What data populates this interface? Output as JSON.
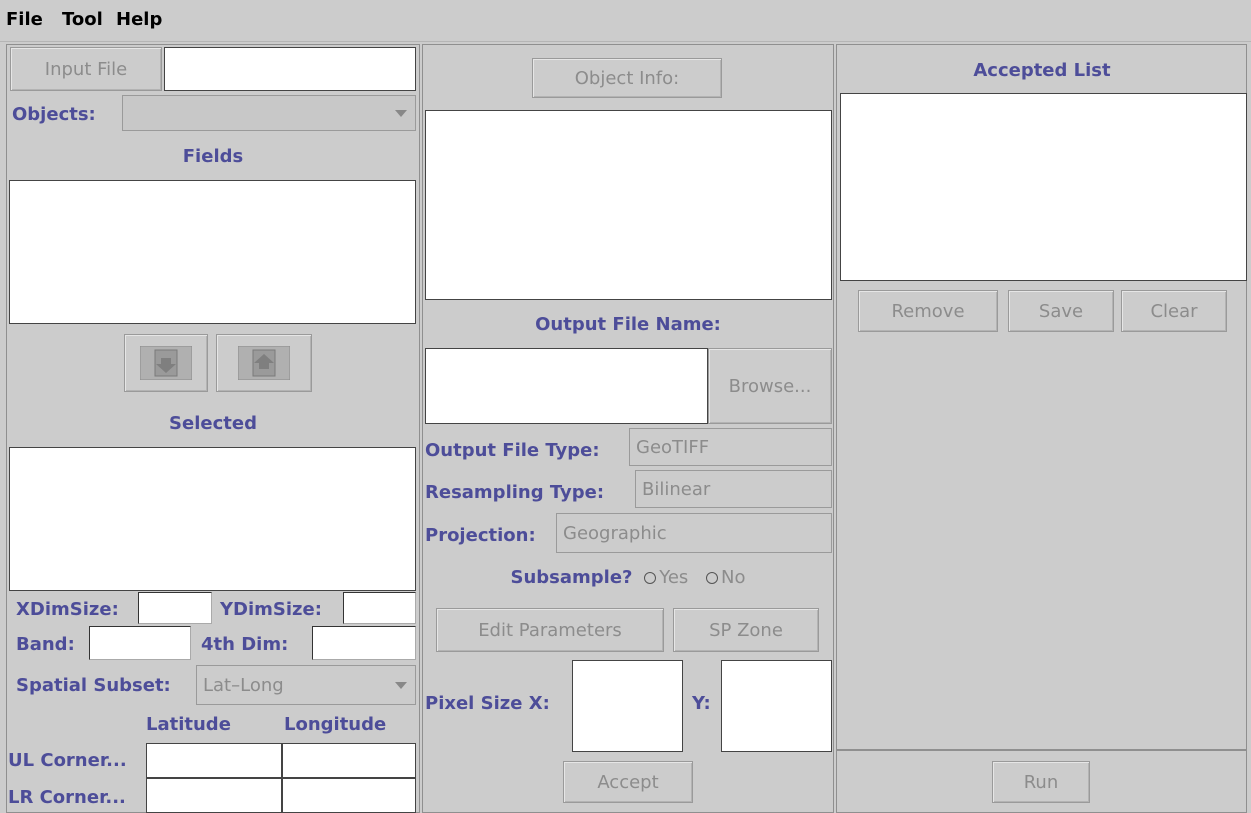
{
  "menu": {
    "file": "File",
    "tool": "Tool",
    "help": "Help"
  },
  "left": {
    "input_file_button": "Input File",
    "input_file_value": "",
    "objects_label": "Objects:",
    "objects_selected": "",
    "fields_label": "Fields",
    "selected_label": "Selected",
    "xdimsize_label": "XDimSize:",
    "ydimsize_label": "YDimSize:",
    "band_label": "Band:",
    "fourth_dim_label": "4th Dim:",
    "spatial_subset_label": "Spatial Subset:",
    "spatial_subset_value": "Lat–Long",
    "latitude_label": "Latitude",
    "longitude_label": "Longitude",
    "ul_corner_label": "UL Corner...",
    "lr_corner_label": "LR Corner..."
  },
  "middle": {
    "object_info_button": "Object Info:",
    "output_file_name_label": "Output File Name:",
    "browse_button": "Browse...",
    "output_file_type_label": "Output File Type:",
    "output_file_type_value": "GeoTIFF",
    "resampling_type_label": "Resampling Type:",
    "resampling_type_value": "Bilinear",
    "projection_label": "Projection:",
    "projection_value": "Geographic",
    "subsample_label": "Subsample?",
    "subsample_yes": "Yes",
    "subsample_no": "No",
    "edit_parameters_button": "Edit Parameters",
    "sp_zone_button": "SP Zone",
    "pixel_size_x_label": "Pixel Size X:",
    "pixel_size_y_label": "Y:",
    "accept_button": "Accept"
  },
  "right": {
    "accepted_list_label": "Accepted List",
    "remove_button": "Remove",
    "save_button": "Save",
    "clear_button": "Clear",
    "run_button": "Run"
  },
  "colors": {
    "background": "#cccccc",
    "label_text": "#4d4d99",
    "disabled_text": "#8c8c8c"
  }
}
